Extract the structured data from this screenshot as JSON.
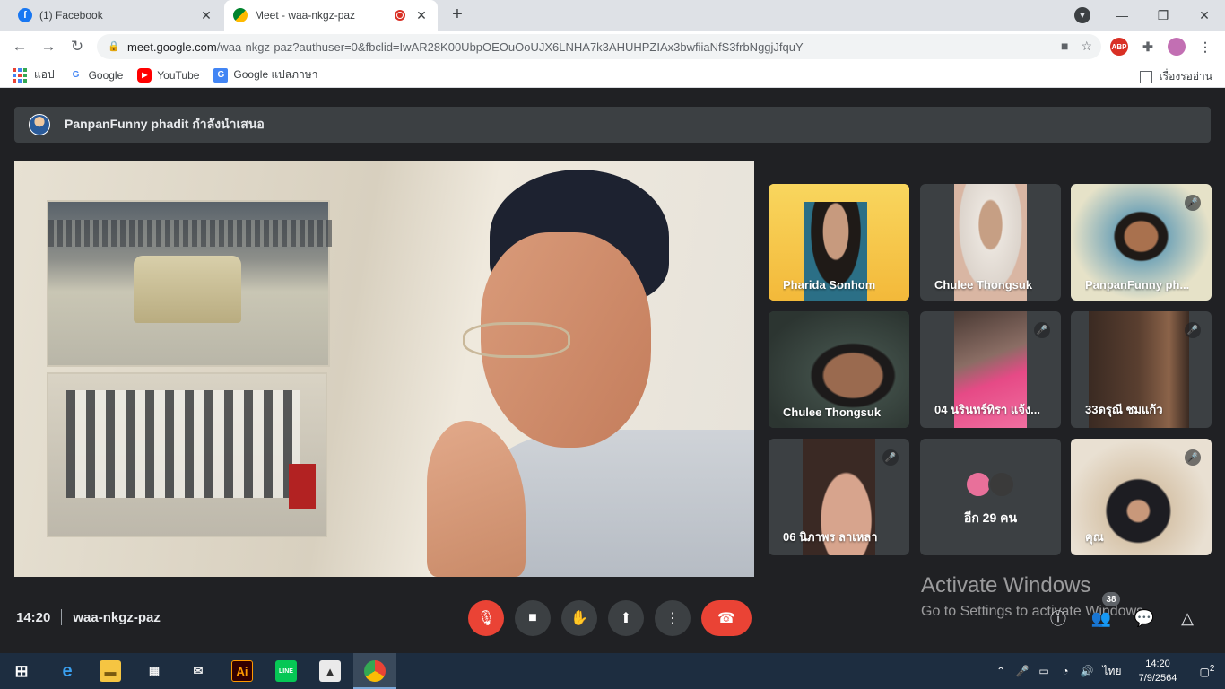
{
  "browser": {
    "tabs": [
      {
        "label": "(1) Facebook",
        "icon": "facebook-icon",
        "active": false
      },
      {
        "label": "Meet - waa-nkgz-paz",
        "icon": "google-meet-icon",
        "active": true
      }
    ],
    "url": {
      "host": "meet.google.com",
      "path": "/waa-nkgz-paz?authuser=0&fbclid=IwAR28K00UbpOEOuOoUJX6LNHA7k3AHUHPZIAx3bwfiiaNfS3frbNggjJfquY"
    },
    "extensions": [
      "adblock-plus-icon",
      "extensions-puzzle-icon",
      "profile-avatar-icon",
      "menu-kebab-icon"
    ]
  },
  "bookmarks": {
    "apps_label": "แอป",
    "items": [
      {
        "label": "Google",
        "icon": "google-icon"
      },
      {
        "label": "YouTube",
        "icon": "youtube-icon"
      },
      {
        "label": "Google แปลภาษา",
        "icon": "google-translate-icon"
      }
    ],
    "reading_list_label": "เรื่องรออ่าน"
  },
  "meet": {
    "presenter_text": "PanpanFunny phadit กำลังนำเสนอ",
    "tiles": [
      {
        "name": "Pharida Sonhom",
        "muted": false
      },
      {
        "name": "Chulee Thongsuk",
        "muted": false
      },
      {
        "name": "PanpanFunny ph...",
        "muted": true
      },
      {
        "name": "Chulee Thongsuk",
        "muted": false
      },
      {
        "name": "04 นรินทร์ทิรา แจ้ง...",
        "muted": true
      },
      {
        "name": "33ดรุณี ชมแก้ว",
        "muted": true
      },
      {
        "name": "06 นิภาพร ลาเหลา",
        "muted": true
      },
      {
        "name": "คุณ",
        "muted": true
      }
    ],
    "more_participants": "อีก 29 คน",
    "time": "14:20",
    "meeting_code": "waa-nkgz-paz",
    "participant_count": "38",
    "activate_title": "Activate Windows",
    "activate_sub": "Go to Settings to activate Windows."
  },
  "taskbar": {
    "apps": [
      "windows-start-icon",
      "edge-icon",
      "file-explorer-icon",
      "store-icon",
      "mail-icon",
      "illustrator-icon",
      "line-icon",
      "photos-icon",
      "chrome-icon"
    ],
    "illustrator_label": "Ai",
    "line_label": "LINE",
    "lang": "ไทย",
    "time": "14:20",
    "date": "7/9/2564",
    "notifications": "2"
  }
}
